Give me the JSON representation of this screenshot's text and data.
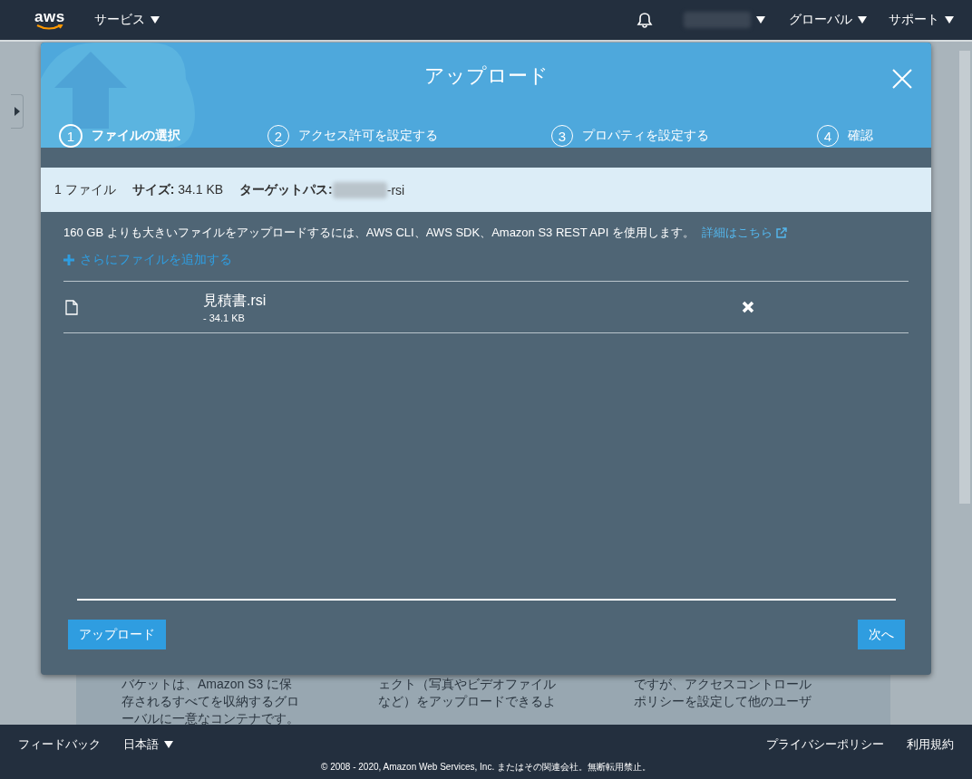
{
  "top_nav": {
    "logo": "aws",
    "services": "サービス",
    "region": "グローバル",
    "support": "サポート"
  },
  "background_card": {
    "columns": [
      [
        "バケットは、Amazon S3 に保",
        "存されるすべてを収納するグロ",
        "ーバルに一意なコンテナです。"
      ],
      [
        "ェクト（写真やビデオファイル",
        "など）をアップロードできるよ"
      ],
      [
        "ですが、アクセスコントロール",
        "ポリシーを設定して他のユーザ"
      ]
    ]
  },
  "modal": {
    "title": "アップロード",
    "steps": [
      {
        "number": "1",
        "label": "ファイルの選択",
        "selected": true
      },
      {
        "number": "2",
        "label": "アクセス許可を設定する",
        "selected": false
      },
      {
        "number": "3",
        "label": "プロパティを設定する",
        "selected": false
      },
      {
        "number": "4",
        "label": "確認",
        "selected": false
      }
    ],
    "summary": {
      "count": "1 ファイル",
      "size_label": "サイズ:",
      "size": "34.1 KB",
      "target_label": "ターゲットパス:",
      "target_suffix": "-rsi"
    },
    "notice": "160 GB よりも大きいファイルをアップロードするには、AWS CLI、AWS SDK、Amazon S3 REST API を使用します。",
    "notice_link": "詳細はこちら",
    "add_files": "さらにファイルを追加する",
    "files": [
      {
        "name": "見積書.rsi",
        "size": "- 34.1 KB"
      }
    ],
    "buttons": {
      "upload": "アップロード",
      "next": "次へ"
    }
  },
  "footer": {
    "feedback": "フィードバック",
    "language": "日本語",
    "privacy": "プライバシーポリシー",
    "terms": "利用規約",
    "copyright": "© 2008 - 2020, Amazon Web Services, Inc. またはその関連会社。無断転用禁止。"
  }
}
